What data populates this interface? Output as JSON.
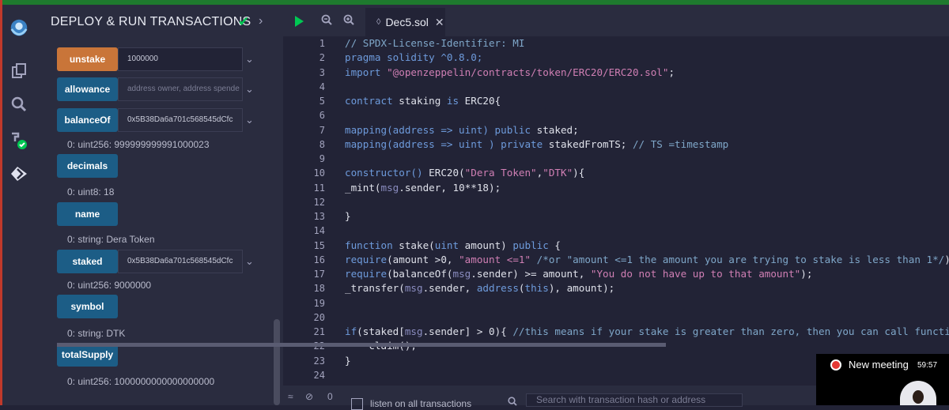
{
  "panel": {
    "title": "DEPLOY & RUN TRANSACTIONS"
  },
  "functions": [
    {
      "label": "unstake",
      "value": "1000000"
    },
    {
      "label": "allowance",
      "placeholder": "address owner, address spende"
    },
    {
      "label": "balanceOf",
      "value": "0x5B38Da6a701c568545dCfc"
    },
    {
      "label": "decimals"
    },
    {
      "label": "name"
    },
    {
      "label": "staked",
      "value": "0x5B38Da6a701c568545dCfc"
    },
    {
      "label": "symbol"
    },
    {
      "label": "totalSupply"
    }
  ],
  "outputs": {
    "balanceOf": "0: uint256: 999999999991000023",
    "decimals": "0: uint8: 18",
    "name": "0: string: Dera Token",
    "staked": "0: uint256: 9000000",
    "symbol": "0: string: DTK",
    "totalSupply": "0: uint256: 1000000000000000000"
  },
  "editor": {
    "tab_name": "Dec5.sol",
    "lines": [
      {
        "n": "1",
        "parts": [
          [
            "comment",
            "// SPDX-License-Identifier: MI"
          ]
        ]
      },
      {
        "n": "2",
        "parts": [
          [
            "kw",
            "pragma solidity ^0.8.0;"
          ]
        ]
      },
      {
        "n": "3",
        "parts": [
          [
            "kw",
            "import "
          ],
          [
            "str",
            "\"@openzeppelin/contracts/token/ERC20/ERC20.sol\""
          ],
          [
            "plain",
            ";"
          ]
        ]
      },
      {
        "n": "4",
        "parts": []
      },
      {
        "n": "5",
        "parts": [
          [
            "kw",
            "contract "
          ],
          [
            "plain",
            "staking "
          ],
          [
            "kw",
            "is "
          ],
          [
            "plain",
            "ERC20{"
          ]
        ]
      },
      {
        "n": "6",
        "parts": []
      },
      {
        "n": "7",
        "parts": [
          [
            "kw",
            "mapping(address => uint) public "
          ],
          [
            "plain",
            "staked;"
          ]
        ]
      },
      {
        "n": "8",
        "parts": [
          [
            "kw",
            "mapping(address => uint ) private "
          ],
          [
            "plain",
            "stakedFromTS; "
          ],
          [
            "comment",
            "// TS =timestamp"
          ]
        ]
      },
      {
        "n": "9",
        "parts": []
      },
      {
        "n": "10",
        "parts": [
          [
            "kw",
            "constructor() "
          ],
          [
            "plain",
            "ERC20("
          ],
          [
            "str",
            "\"Dera Token\""
          ],
          [
            "plain",
            ","
          ],
          [
            "str",
            "\"DTK\""
          ],
          [
            "plain",
            "){"
          ]
        ]
      },
      {
        "n": "11",
        "parts": [
          [
            "plain",
            "_mint("
          ],
          [
            "msg",
            "msg"
          ],
          [
            "plain",
            ".sender, 10**18);"
          ]
        ]
      },
      {
        "n": "12",
        "parts": []
      },
      {
        "n": "13",
        "parts": [
          [
            "plain",
            "}"
          ]
        ]
      },
      {
        "n": "14",
        "parts": []
      },
      {
        "n": "15",
        "parts": [
          [
            "kw",
            "function "
          ],
          [
            "plain",
            "stake("
          ],
          [
            "kw",
            "uint "
          ],
          [
            "plain",
            "amount) "
          ],
          [
            "kw",
            "public "
          ],
          [
            "plain",
            "{"
          ]
        ]
      },
      {
        "n": "16",
        "parts": [
          [
            "kw",
            "require"
          ],
          [
            "plain",
            "(amount >0, "
          ],
          [
            "str",
            "\"amount <=1\""
          ],
          [
            "plain",
            " "
          ],
          [
            "comment",
            "/*or \"amount <=1 the amount you are trying to stake is less than 1*/"
          ],
          [
            "plain",
            ");"
          ]
        ]
      },
      {
        "n": "17",
        "parts": [
          [
            "kw",
            "require"
          ],
          [
            "plain",
            "(balanceOf("
          ],
          [
            "msg",
            "msg"
          ],
          [
            "plain",
            ".sender) >= amount, "
          ],
          [
            "str",
            "\"You do not have up to that amount\""
          ],
          [
            "plain",
            ");"
          ]
        ]
      },
      {
        "n": "18",
        "parts": [
          [
            "plain",
            "_transfer("
          ],
          [
            "msg",
            "msg"
          ],
          [
            "plain",
            ".sender, "
          ],
          [
            "kw",
            "address"
          ],
          [
            "plain",
            "("
          ],
          [
            "kw",
            "this"
          ],
          [
            "plain",
            "), amount);"
          ]
        ]
      },
      {
        "n": "19",
        "parts": []
      },
      {
        "n": "20",
        "parts": []
      },
      {
        "n": "21",
        "parts": [
          [
            "kw",
            "if"
          ],
          [
            "plain",
            "(staked["
          ],
          [
            "msg",
            "msg"
          ],
          [
            "plain",
            ".sender] > 0){ "
          ],
          [
            "comment",
            "//this means if your stake is greater than zero, then you can call functio"
          ]
        ]
      },
      {
        "n": "22",
        "parts": [
          [
            "plain",
            "    claim();"
          ]
        ]
      },
      {
        "n": "23",
        "parts": [
          [
            "plain",
            "}"
          ]
        ]
      },
      {
        "n": "24",
        "parts": []
      }
    ]
  },
  "terminal": {
    "listen_label": "listen on all transactions",
    "search_placeholder": "Search with transaction hash or address",
    "count": "0"
  },
  "meeting": {
    "label": "New meeting",
    "time": "59:57"
  }
}
